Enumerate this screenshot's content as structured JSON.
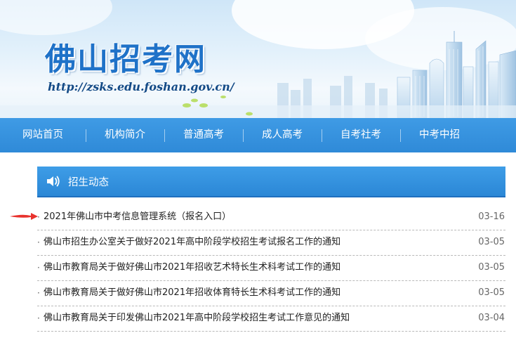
{
  "header": {
    "site_name": "佛山招考网",
    "site_url": "http://zsks.edu.foshan.gov.cn/"
  },
  "nav": {
    "items": [
      {
        "label": "网站首页"
      },
      {
        "label": "机构简介"
      },
      {
        "label": "普通高考"
      },
      {
        "label": "成人高考"
      },
      {
        "label": "自考社考"
      },
      {
        "label": "中考中招"
      }
    ]
  },
  "panel": {
    "title": "招生动态",
    "icon": "speaker-icon"
  },
  "news": [
    {
      "title": "2021年佛山市中考信息管理系统（报名入口）",
      "date": "03-16"
    },
    {
      "title": "佛山市招生办公室关于做好2021年高中阶段学校招生考试报名工作的通知",
      "date": "03-05"
    },
    {
      "title": "佛山市教育局关于做好佛山市2021年招收艺术特长生术科考试工作的通知",
      "date": "03-05"
    },
    {
      "title": "佛山市教育局关于做好佛山市2021年招收体育特长生术科考试工作的通知",
      "date": "03-05"
    },
    {
      "title": "佛山市教育局关于印发佛山市2021年高中阶段学校招生考试工作意见的通知",
      "date": "03-04"
    }
  ],
  "colors": {
    "nav": "#3394df",
    "logo": "#1f72c8",
    "annotation_arrow": "#e8322d"
  }
}
